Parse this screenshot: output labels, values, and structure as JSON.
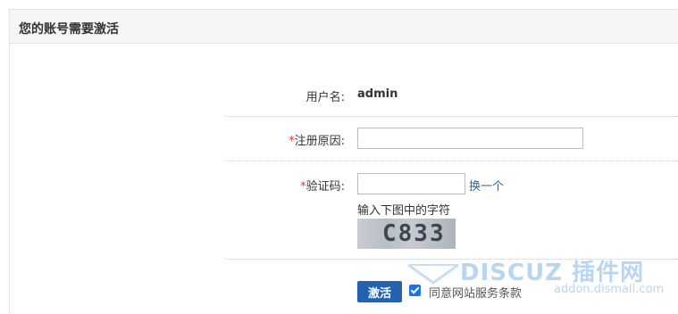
{
  "panel": {
    "title": "您的账号需要激活"
  },
  "form": {
    "username": {
      "label": "用户名:",
      "value": "admin"
    },
    "reason": {
      "required_mark": "*",
      "label": "注册原因:",
      "value": ""
    },
    "captcha": {
      "required_mark": "*",
      "label": "验证码:",
      "value": "",
      "refresh_label": "换一个",
      "hint": "输入下图中的字符",
      "image_text": "C833"
    },
    "submit_label": "激活",
    "agree": {
      "checked": true,
      "label": "同意网站服务条款"
    }
  },
  "watermark": {
    "brand": "DISCUZ 插件网",
    "site": "addon.dismall.com"
  }
}
